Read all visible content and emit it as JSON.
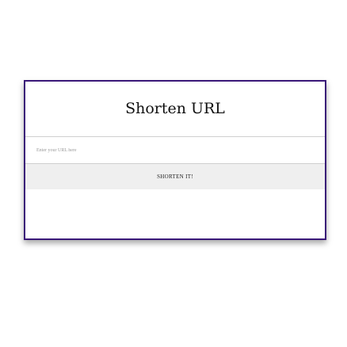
{
  "card": {
    "title": "Shorten URL",
    "url_input": {
      "placeholder": "Enter your URL here",
      "value": ""
    },
    "submit_label": "SHORTEN IT!"
  },
  "colors": {
    "card_border": "#3a1878",
    "button_background": "#efefef"
  }
}
